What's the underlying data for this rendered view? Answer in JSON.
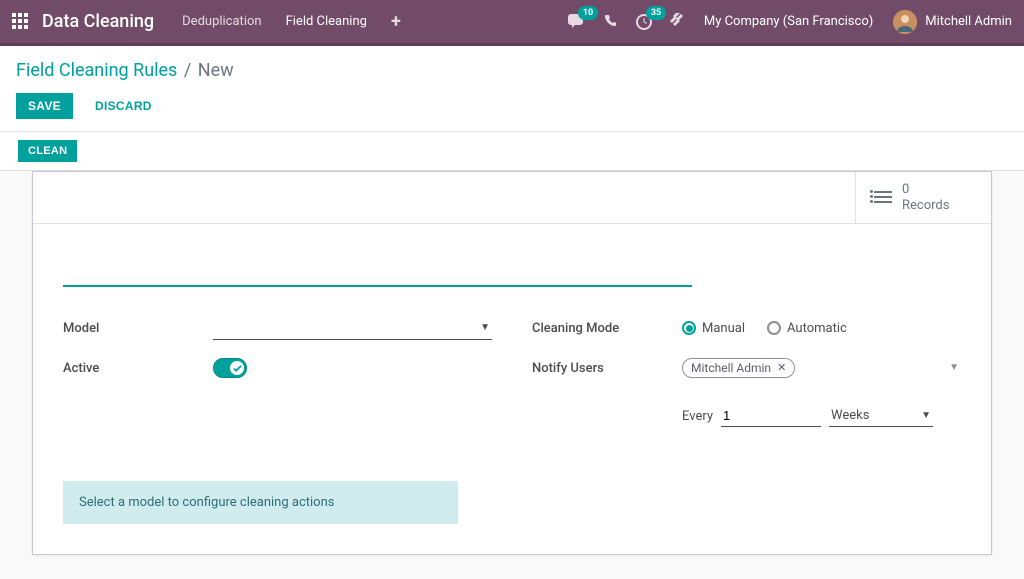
{
  "topbar": {
    "app_title": "Data Cleaning",
    "nav": [
      "Deduplication",
      "Field Cleaning"
    ],
    "msg_badge": "10",
    "activity_badge": "35",
    "company": "My Company (San Francisco)",
    "user_name": "Mitchell Admin"
  },
  "breadcrumb": {
    "parent": "Field Cleaning Rules",
    "current": "New",
    "sep": "/"
  },
  "buttons": {
    "save": "SAVE",
    "discard": "DISCARD",
    "clean": "CLEAN"
  },
  "stat": {
    "count": "0",
    "label": "Records"
  },
  "form": {
    "name_value": "",
    "labels": {
      "model": "Model",
      "active": "Active",
      "cleaning_mode": "Cleaning Mode",
      "notify_users": "Notify Users",
      "every": "Every"
    },
    "model_value": "",
    "active": true,
    "cleaning_mode_options": {
      "manual": "Manual",
      "automatic": "Automatic"
    },
    "cleaning_mode_value": "manual",
    "notify_users_tags": [
      "Mitchell Admin"
    ],
    "interval_number": "1",
    "interval_unit": "Weeks"
  },
  "notice": "Select a model to configure cleaning actions"
}
